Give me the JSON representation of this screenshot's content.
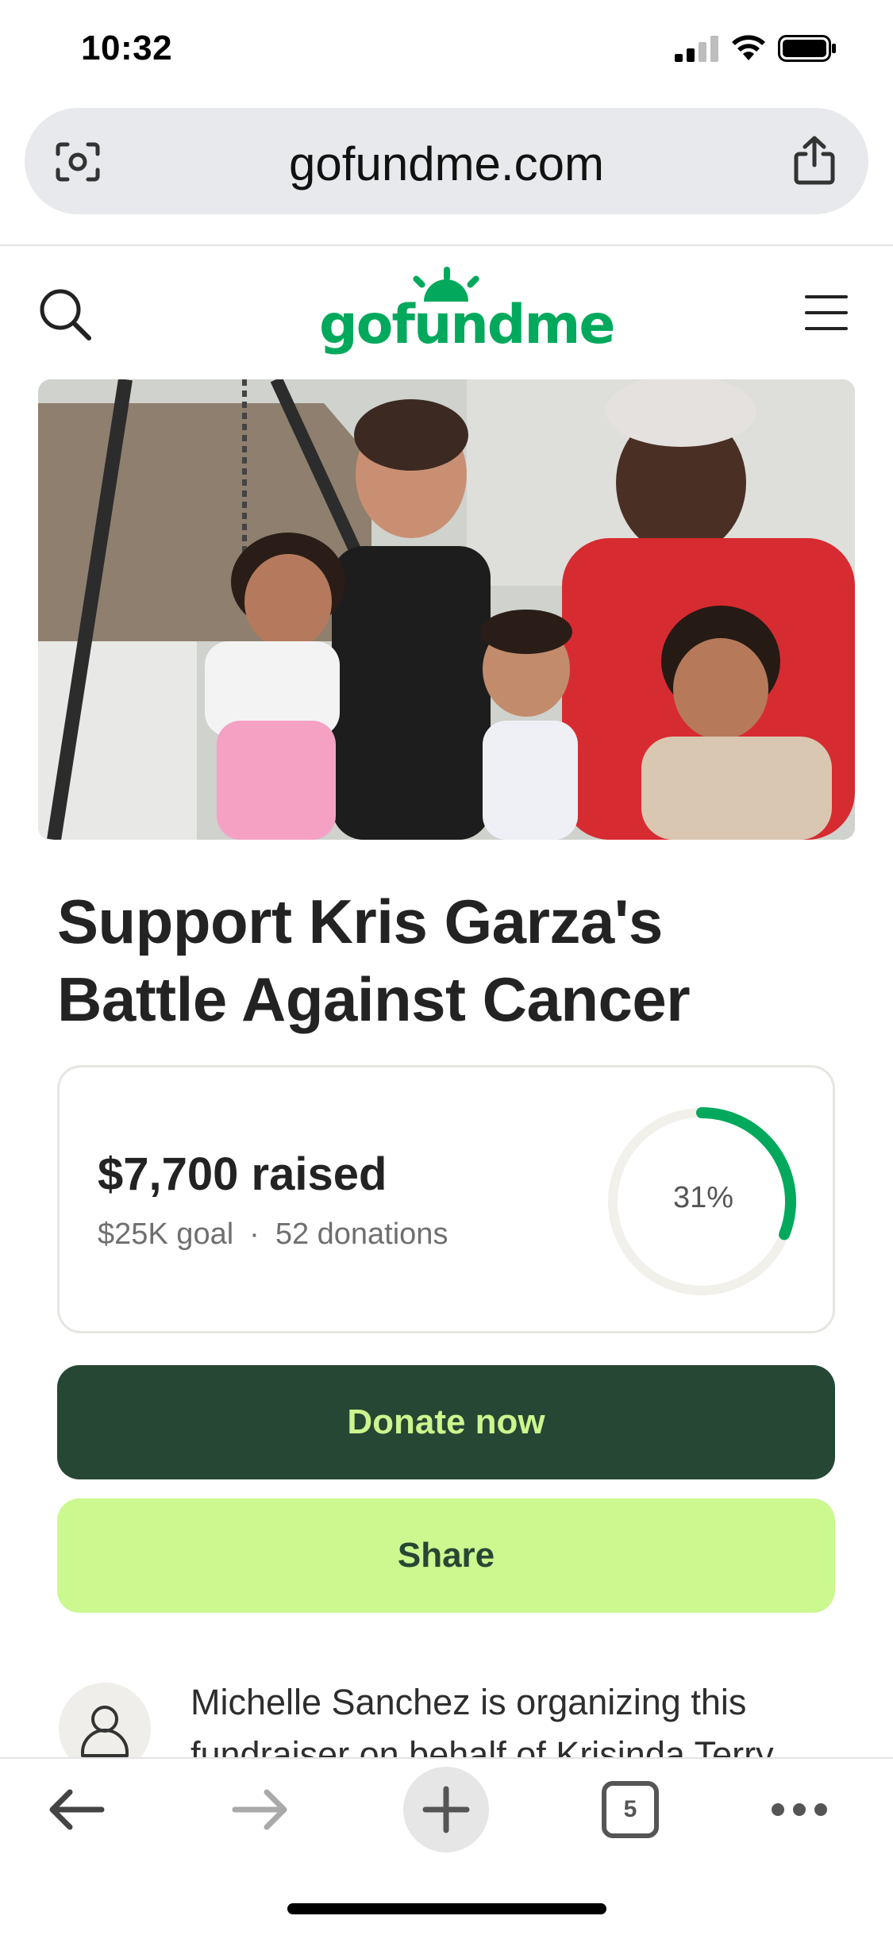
{
  "status_bar": {
    "time": "10:32"
  },
  "browser": {
    "url": "gofundme.com",
    "open_tabs": "5",
    "icons": [
      "camera-lens-icon",
      "share-icon",
      "back-arrow-icon",
      "forward-arrow-icon",
      "new-tab-plus-icon",
      "tabs-icon",
      "more-icon"
    ]
  },
  "site": {
    "logo": "gofundme",
    "brand_color": "#02a95c"
  },
  "campaign": {
    "title_line1": "Support Kris Garza's",
    "title_line2": "Battle Against Cancer",
    "raised": "$7,700 raised",
    "goal": "$25K goal",
    "separator": "·",
    "donations": "52 donations",
    "progress_label": "31%",
    "progress_fraction": 0.31
  },
  "actions": {
    "donate_label": "Donate now",
    "share_label": "Share"
  },
  "organizer": {
    "text": "Michelle Sanchez is organizing this fundraiser on behalf of Krisinda Terry"
  },
  "colors": {
    "donate_bg": "#264734",
    "donate_text": "#cdf58e",
    "share_bg": "#cbf88f",
    "progress_green": "#02a95c"
  }
}
